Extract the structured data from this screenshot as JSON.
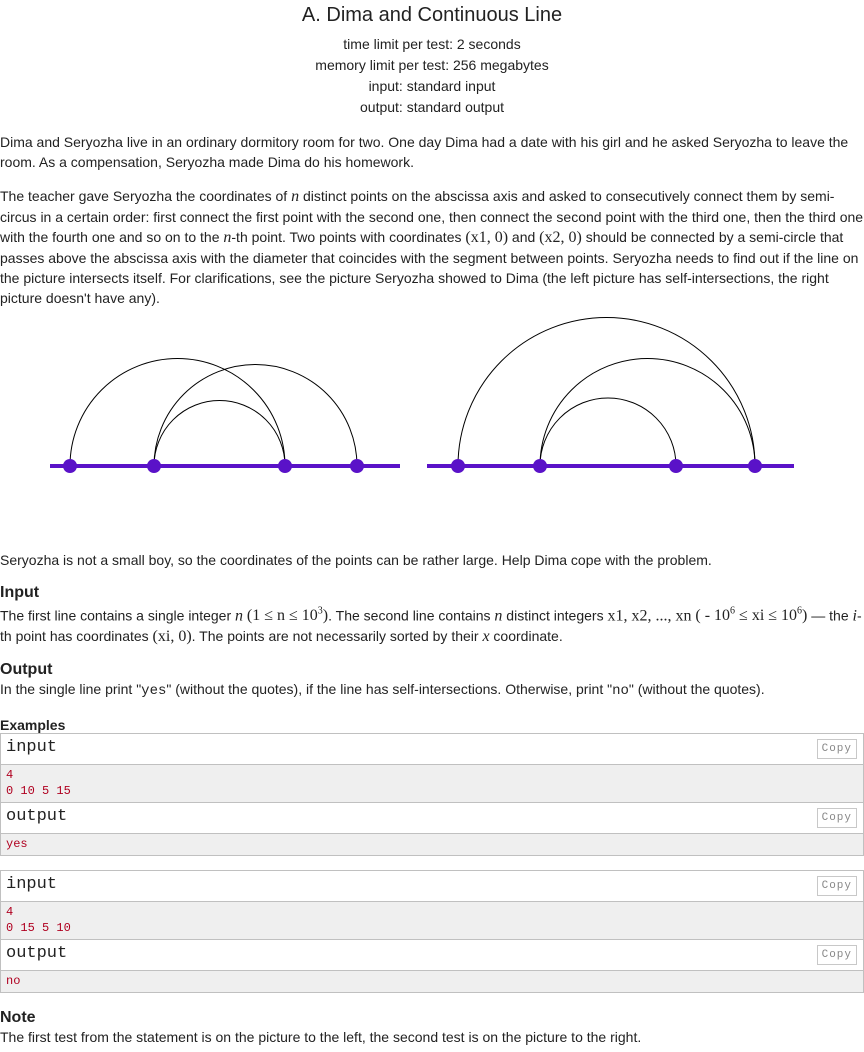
{
  "header": {
    "title": "A. Dima and Continuous Line",
    "time_limit": "time limit per test: 2 seconds",
    "memory_limit": "memory limit per test: 256 megabytes",
    "input": "input: standard input",
    "output": "output: standard output"
  },
  "statement": {
    "p1": "Dima and Seryozha live in an ordinary dormitory room for two. One day Dima had a date with his girl and he asked Seryozha to leave the room. As a compensation, Seryozha made Dima do his homework.",
    "p2_a": "The teacher gave Seryozha the coordinates of ",
    "p2_n1": "n",
    "p2_b": " distinct points on the abscissa axis and asked to consecutively connect them by semi-circus in a certain order: first connect the first point with the second one, then connect the second point with the third one, then the third one with the fourth one and so on to the ",
    "p2_n2": "n",
    "p2_c": "-th point. Two points with coordinates ",
    "p2_coord1": "(x1, 0)",
    "p2_and": " and ",
    "p2_coord2": "(x2, 0)",
    "p2_d": " should be connected by a semi-circle that passes above the abscissa axis with the diameter that coincides with the segment between points. Seryozha needs to find out if the line on the picture intersects itself. For clarifications, see the picture Seryozha showed to Dima (the left picture has self-intersections, the right picture doesn't have any).",
    "p3": "Seryozha is not a small boy, so the coordinates of the points can be rather large. Help Dima cope with the problem."
  },
  "input_section": {
    "title": "Input",
    "a": "The first line contains a single integer ",
    "n": "n",
    "constraint1": "(1 ≤ n ≤ 10",
    "constraint1_sup": "3",
    "constraint1_end": ")",
    "b": ". The second line contains ",
    "n2": "n",
    "c": " distinct integers ",
    "seq": "x1, x2, ..., xn",
    "constraint2": "( - 10",
    "constraint2_sup": "6",
    "constraint2_mid": " ≤ xi ≤ 10",
    "constraint2_sup2": "6",
    "constraint2_end": ")",
    "d": " — the ",
    "i": "i",
    "e": "-th point has coordinates ",
    "coord": "(xi, 0)",
    "f": ". The points are not necessarily sorted by their ",
    "x": "x",
    "g": " coordinate."
  },
  "output_section": {
    "title": "Output",
    "a": "In the single line print \"",
    "yes": "yes",
    "b": "\" (without the quotes), if the line has self-intersections. Otherwise, print \"",
    "no": "no",
    "c": "\" (without the quotes)."
  },
  "examples": {
    "title": "Examples",
    "input_label": "input",
    "output_label": "output",
    "copy_label": "Copy",
    "tests": [
      {
        "input": "4\n0 10 5 15",
        "output": "yes"
      },
      {
        "input": "4\n0 15 5 10",
        "output": "no"
      }
    ]
  },
  "note": {
    "title": "Note",
    "text": "The first test from the statement is on the picture to the left, the second test is on the picture to the right."
  },
  "figure": {
    "left_points": [
      0,
      10,
      5,
      15
    ],
    "right_points": [
      0,
      15,
      5,
      10
    ],
    "axis_color": "#5a12c8",
    "point_color": "#5a12c8",
    "arc_color": "#000000"
  }
}
